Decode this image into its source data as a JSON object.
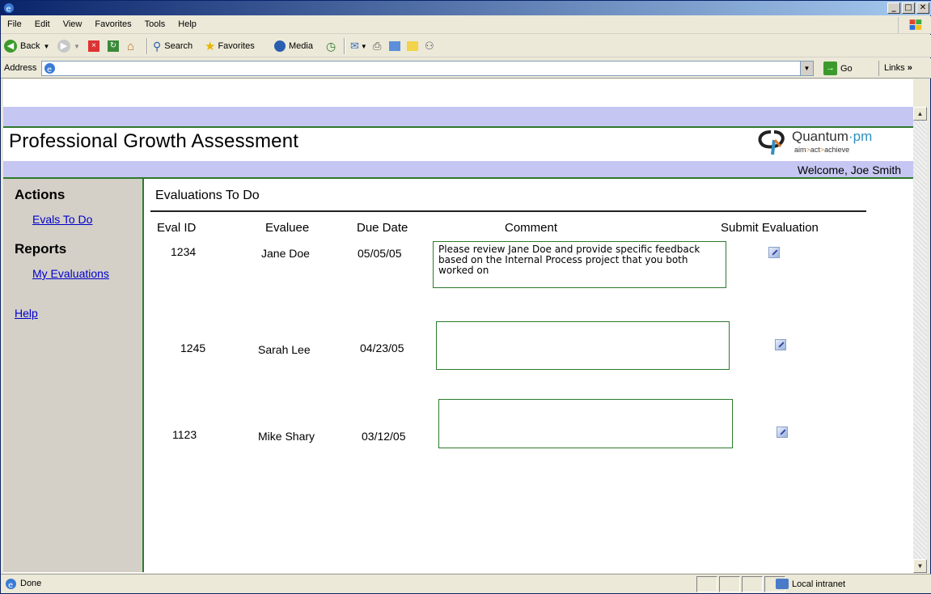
{
  "browser": {
    "menu": [
      "File",
      "Edit",
      "View",
      "Favorites",
      "Tools",
      "Help"
    ],
    "toolbar": {
      "back": "Back",
      "search": "Search",
      "favorites": "Favorites",
      "media": "Media"
    },
    "address_label": "Address",
    "go_label": "Go",
    "links_label": "Links",
    "links_chevron": "»",
    "status": "Done",
    "zone": "Local intranet"
  },
  "app": {
    "title": "Professional Growth Assessment",
    "logo_name": "Quantum",
    "logo_suffix": "pm",
    "logo_tagline_parts": [
      "aim",
      "act",
      "achieve"
    ],
    "welcome": "Welcome, Joe Smith"
  },
  "sidebar": {
    "actions_heading": "Actions",
    "evals_link": "Evals To Do",
    "reports_heading": "Reports",
    "my_evals_link": "My Evaluations",
    "help_link": "Help"
  },
  "main": {
    "section_title": "Evaluations To Do",
    "columns": [
      "Eval ID",
      "Evaluee",
      "Due Date",
      "Comment",
      "Submit Evaluation"
    ],
    "rows": [
      {
        "id": "1234",
        "evaluee": "Jane Doe",
        "due": "05/05/05",
        "comment": "Please review Jane Doe and provide specific feedback based on the Internal Process project that you both worked on"
      },
      {
        "id": "1245",
        "evaluee": "Sarah Lee",
        "due": "04/23/05",
        "comment": ""
      },
      {
        "id": "1123",
        "evaluee": "Mike Shary",
        "due": "03/12/05",
        "comment": ""
      }
    ]
  }
}
